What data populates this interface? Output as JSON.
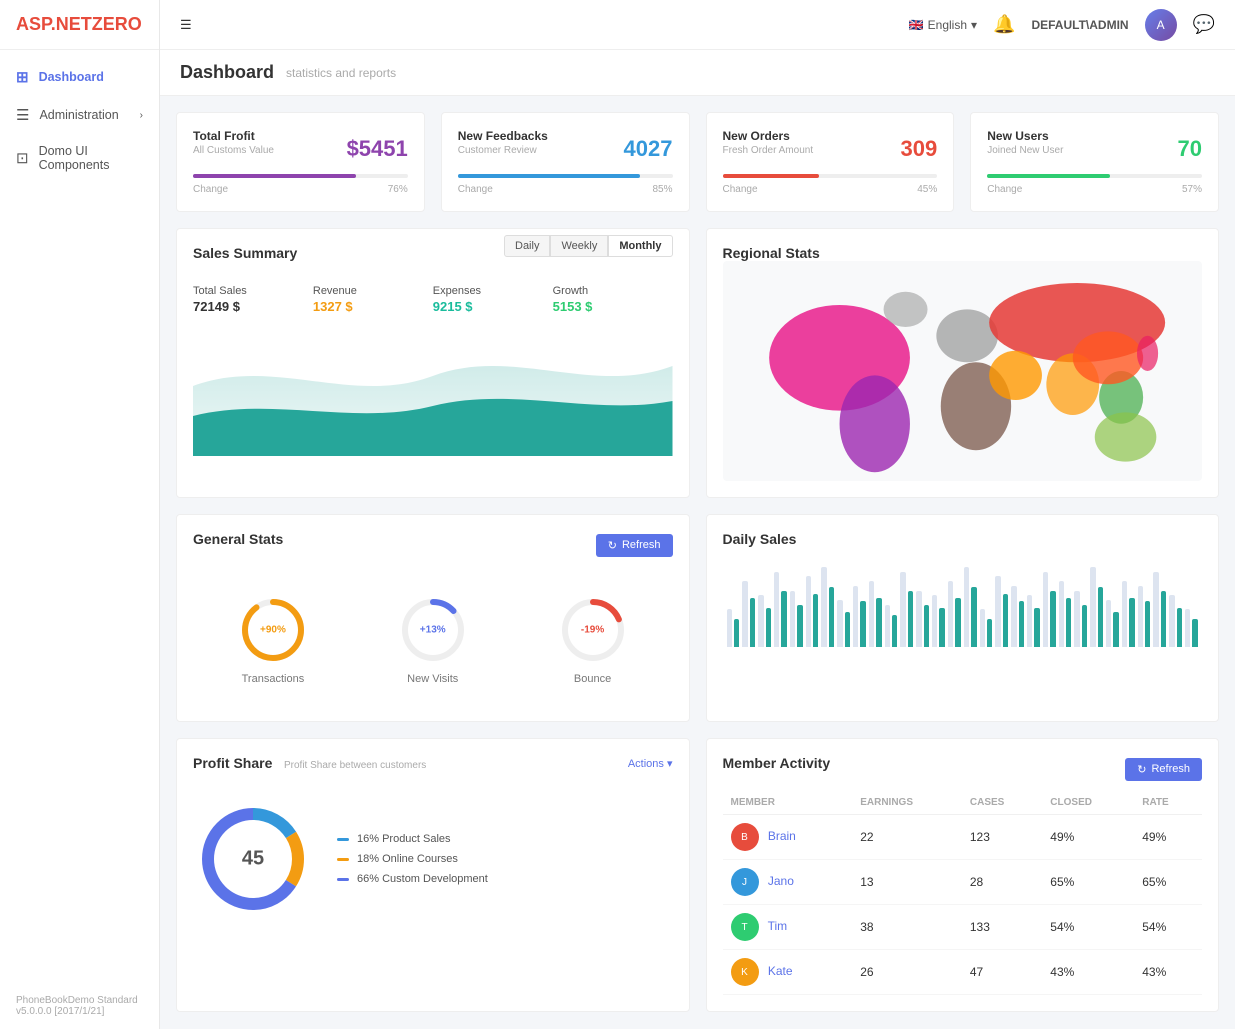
{
  "app": {
    "logo": "ASP.NET ZERO",
    "logo_asp": "ASP.",
    "logo_net": "NET",
    "logo_zero": "ZERO"
  },
  "topnav": {
    "language": "English",
    "user": "DEFAULT\\ADMIN",
    "hamburger": "☰"
  },
  "sidebar": {
    "items": [
      {
        "id": "dashboard",
        "label": "Dashboard",
        "icon": "⊞",
        "active": true
      },
      {
        "id": "administration",
        "label": "Administration",
        "icon": "☰",
        "arrow": "›"
      },
      {
        "id": "domo",
        "label": "Domo UI Components",
        "icon": "⊡"
      }
    ]
  },
  "page": {
    "title": "Dashboard",
    "subtitle": "statistics and reports"
  },
  "stats": [
    {
      "id": "total-profit",
      "title": "Total Frofit",
      "sub": "All Customs Value",
      "value": "$5451",
      "value_color": "#8e44ad",
      "progress": 76,
      "bar_color": "#8e44ad",
      "change_label": "Change",
      "change_pct": "76%"
    },
    {
      "id": "new-feedbacks",
      "title": "New Feedbacks",
      "sub": "Customer Review",
      "value": "4027",
      "value_color": "#3498db",
      "progress": 85,
      "bar_color": "#3498db",
      "change_label": "Change",
      "change_pct": "85%"
    },
    {
      "id": "new-orders",
      "title": "New Orders",
      "sub": "Fresh Order Amount",
      "value": "309",
      "value_color": "#e74c3c",
      "progress": 45,
      "bar_color": "#e74c3c",
      "change_label": "Change",
      "change_pct": "45%"
    },
    {
      "id": "new-users",
      "title": "New Users",
      "sub": "Joined New User",
      "value": "70",
      "value_color": "#2ecc71",
      "progress": 57,
      "bar_color": "#2ecc71",
      "change_label": "Change",
      "change_pct": "57%"
    }
  ],
  "sales_summary": {
    "title": "Sales Summary",
    "tabs": [
      "Daily",
      "Weekly",
      "Monthly"
    ],
    "active_tab": "Daily",
    "metrics": [
      {
        "label": "Total Sales",
        "value": "72149 $",
        "color": "default"
      },
      {
        "label": "Revenue",
        "value": "1327 $",
        "color": "orange"
      },
      {
        "label": "Expenses",
        "value": "9215 $",
        "color": "cyan"
      },
      {
        "label": "Growth",
        "value": "5153 $",
        "color": "green"
      }
    ]
  },
  "regional_stats": {
    "title": "Regional Stats"
  },
  "general_stats": {
    "title": "General Stats",
    "refresh_label": "Refresh",
    "items": [
      {
        "id": "transactions",
        "label": "Transactions",
        "value": "+90%",
        "color": "#f39c12",
        "pct": 90
      },
      {
        "id": "new-visits",
        "label": "New Visits",
        "value": "+13%",
        "color": "#5b73e8",
        "pct": 13
      },
      {
        "id": "bounce",
        "label": "Bounce",
        "value": "-19%",
        "color": "#e74c3c",
        "pct": 19
      }
    ]
  },
  "daily_sales": {
    "title": "Daily Sales",
    "bars": [
      40,
      70,
      55,
      80,
      60,
      75,
      85,
      50,
      65,
      70,
      45,
      80,
      60,
      55,
      70,
      85,
      40,
      75,
      65,
      55,
      80,
      70,
      60,
      85,
      50,
      70,
      65,
      80,
      55,
      40
    ]
  },
  "profit_share": {
    "title": "Profit Share",
    "subtitle": "Profit Share between customers",
    "actions_label": "Actions",
    "center_value": "45",
    "segments": [
      {
        "label": "16% Product Sales",
        "color": "#3498db",
        "pct": 16
      },
      {
        "label": "18% Online Courses",
        "color": "#f39c12",
        "pct": 18
      },
      {
        "label": "66% Custom Development",
        "color": "#5b73e8",
        "pct": 66
      }
    ]
  },
  "member_activity": {
    "title": "Member Activity",
    "refresh_label": "Refresh",
    "columns": [
      "MEMBER",
      "Earnings",
      "CASES",
      "CLOSED",
      "RATE"
    ],
    "rows": [
      {
        "name": "Brain",
        "avatar_color": "#e74c3c",
        "earnings": "22",
        "cases": "123",
        "closed": "49%",
        "rate": "49%"
      },
      {
        "name": "Jano",
        "avatar_color": "#3498db",
        "earnings": "13",
        "cases": "28",
        "closed": "65%",
        "rate": "65%"
      },
      {
        "name": "Tim",
        "avatar_color": "#2ecc71",
        "earnings": "38",
        "cases": "133",
        "closed": "54%",
        "rate": "54%"
      },
      {
        "name": "Kate",
        "avatar_color": "#f39c12",
        "earnings": "26",
        "cases": "47",
        "closed": "43%",
        "rate": "43%"
      }
    ]
  },
  "footer": {
    "text": "PhoneBookDemo Standard",
    "version": "v5.0.0.0 [2017/1/21]"
  }
}
